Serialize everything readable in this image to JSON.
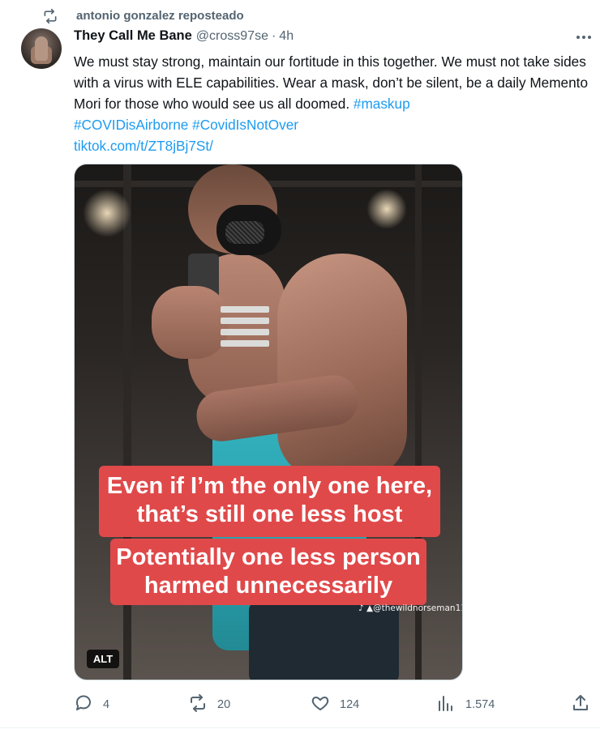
{
  "repost": {
    "label": "antonio gonzalez reposteado",
    "icon": "repost-icon"
  },
  "author": {
    "name": "They Call Me Bane",
    "handle": "@cross97se",
    "separator": "·",
    "time": "4h"
  },
  "more_icon": "more-icon",
  "body": {
    "text": "We must stay strong, maintain our fortitude in this together. We must not take sides with a virus with ELE capabilities. Wear a mask, don’t be silent, be a daily Memento Mori for those who would see us all doomed.",
    "hashtags": [
      "#maskup",
      "#COVIDisAirborne",
      "#CovidIsNotOver"
    ],
    "link": "tiktok.com/t/ZT8jBj7St/"
  },
  "media": {
    "caption_line1": "Even if I’m the only one here,",
    "caption_line2": "that’s still one less host",
    "caption_line3": "Potentially one less person",
    "caption_line4": "harmed unnecessarily",
    "watermark": "♪ ▲@thewildnorseman11",
    "alt_badge": "ALT"
  },
  "actions": {
    "reply": {
      "icon": "reply-icon",
      "count": "4"
    },
    "repost": {
      "icon": "repost-icon",
      "count": "20"
    },
    "like": {
      "icon": "heart-icon",
      "count": "124"
    },
    "views": {
      "icon": "views-icon",
      "count": "1.574"
    },
    "share": {
      "icon": "share-icon"
    }
  },
  "colors": {
    "accent": "#1d9bf0",
    "muted": "#536471",
    "text": "#0f1419",
    "caption_bg": "#e0494a",
    "shirt": "#35b5c1"
  }
}
